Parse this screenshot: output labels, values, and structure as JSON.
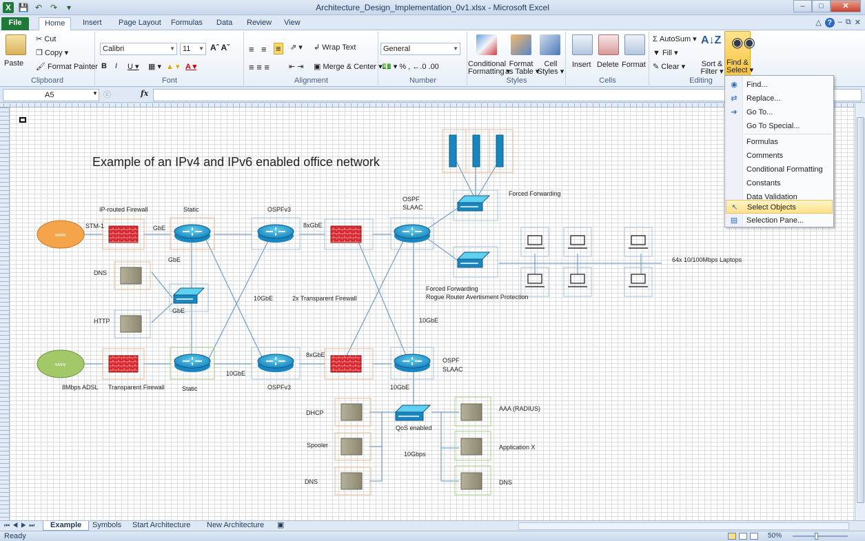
{
  "window": {
    "title": "Architecture_Design_Implementation_0v1.xlsx - Microsoft Excel"
  },
  "tabs": [
    "File",
    "Home",
    "Insert",
    "Page Layout",
    "Formulas",
    "Data",
    "Review",
    "View"
  ],
  "ribbon": {
    "clipboard": {
      "paste": "Paste",
      "cut": "Cut",
      "copy": "Copy",
      "format_painter": "Format Painter",
      "label": "Clipboard"
    },
    "font": {
      "name": "Calibri",
      "size": "11",
      "label": "Font"
    },
    "alignment": {
      "wrap": "Wrap Text",
      "merge": "Merge & Center",
      "label": "Alignment"
    },
    "number": {
      "format": "General",
      "label": "Number"
    },
    "styles": {
      "cond": "Conditional",
      "cond2": "Formatting",
      "fmt": "Format",
      "fmt2": "as Table",
      "cell": "Cell",
      "cell2": "Styles",
      "label": "Styles"
    },
    "cells": {
      "insert": "Insert",
      "delete": "Delete",
      "format": "Format",
      "label": "Cells"
    },
    "editing": {
      "autosum": "AutoSum",
      "fill": "Fill",
      "clear": "Clear",
      "sort": "Sort &",
      "sort2": "Filter",
      "find": "Find &",
      "find2": "Select",
      "label": "Editing"
    }
  },
  "formula_bar": {
    "namebox": "A5",
    "fx": "fx"
  },
  "diagram": {
    "title": "Example of an IPv4 and IPv6 enabled office network",
    "labels": {
      "ip_routed_firewall": "IP-routed Firewall",
      "static_top": "Static",
      "ospfv3_top": "OSPFv3",
      "ospf_top": "OSPF",
      "slaac_top": "SLAAC",
      "stm1": "STM-1",
      "gbe_1": "GbE",
      "gbe_2": "GbE",
      "gbe_3": "GbE",
      "eight_gbe_top": "8xGbE",
      "eight_gbe_bot": "8xGbE",
      "dns_1": "DNS",
      "http": "HTTP",
      "ten_gbe_mid": "10GbE",
      "transparent_fw_2x": "2x Transparent Firewall",
      "ten_gbe_right": "10GbE",
      "forced_forwarding_top": "Forced Forwarding",
      "forced_forwarding_bot": "Forced Forwarding",
      "rogue_router": "Rogue Router Avertisment Protection",
      "laptops": "64x 10/100Mbps Laptops",
      "adsl": "8Mbps ADSL",
      "transparent_fw": "Transparent Firewall",
      "static_bot": "Static",
      "ten_gbe_bot": "10GbE",
      "ospfv3_bot": "OSPFv3",
      "ten_gbe_bot2": "10GbE",
      "ospf_bot": "OSPF",
      "slaac_bot": "SLAAC",
      "dhcp": "DHCP",
      "spooler": "Spooler",
      "dns_2": "DNS",
      "qos": "QoS enabled",
      "ten_gbps": "10Gbps",
      "aaa": "AAA (RADIUS)",
      "app_x": "Application X",
      "dns_3": "DNS",
      "www": "www"
    }
  },
  "sheet_tabs": [
    "Example",
    "Symbols",
    "Start Architecture",
    "New Architecture"
  ],
  "status": {
    "ready": "Ready",
    "zoom": "50%"
  },
  "menu": [
    {
      "label": "Find...",
      "icon": "binoculars-icon"
    },
    {
      "label": "Replace...",
      "icon": "replace-icon"
    },
    {
      "label": "Go To...",
      "icon": "arrow-icon"
    },
    {
      "label": "Go To Special...",
      "icon": ""
    },
    {
      "label": "Formulas",
      "icon": ""
    },
    {
      "label": "Comments",
      "icon": ""
    },
    {
      "label": "Conditional Formatting",
      "icon": ""
    },
    {
      "label": "Constants",
      "icon": ""
    },
    {
      "label": "Data Validation",
      "icon": ""
    },
    {
      "label": "Select Objects",
      "icon": "pointer-icon"
    },
    {
      "label": "Selection Pane...",
      "icon": "selection-pane-icon"
    }
  ]
}
